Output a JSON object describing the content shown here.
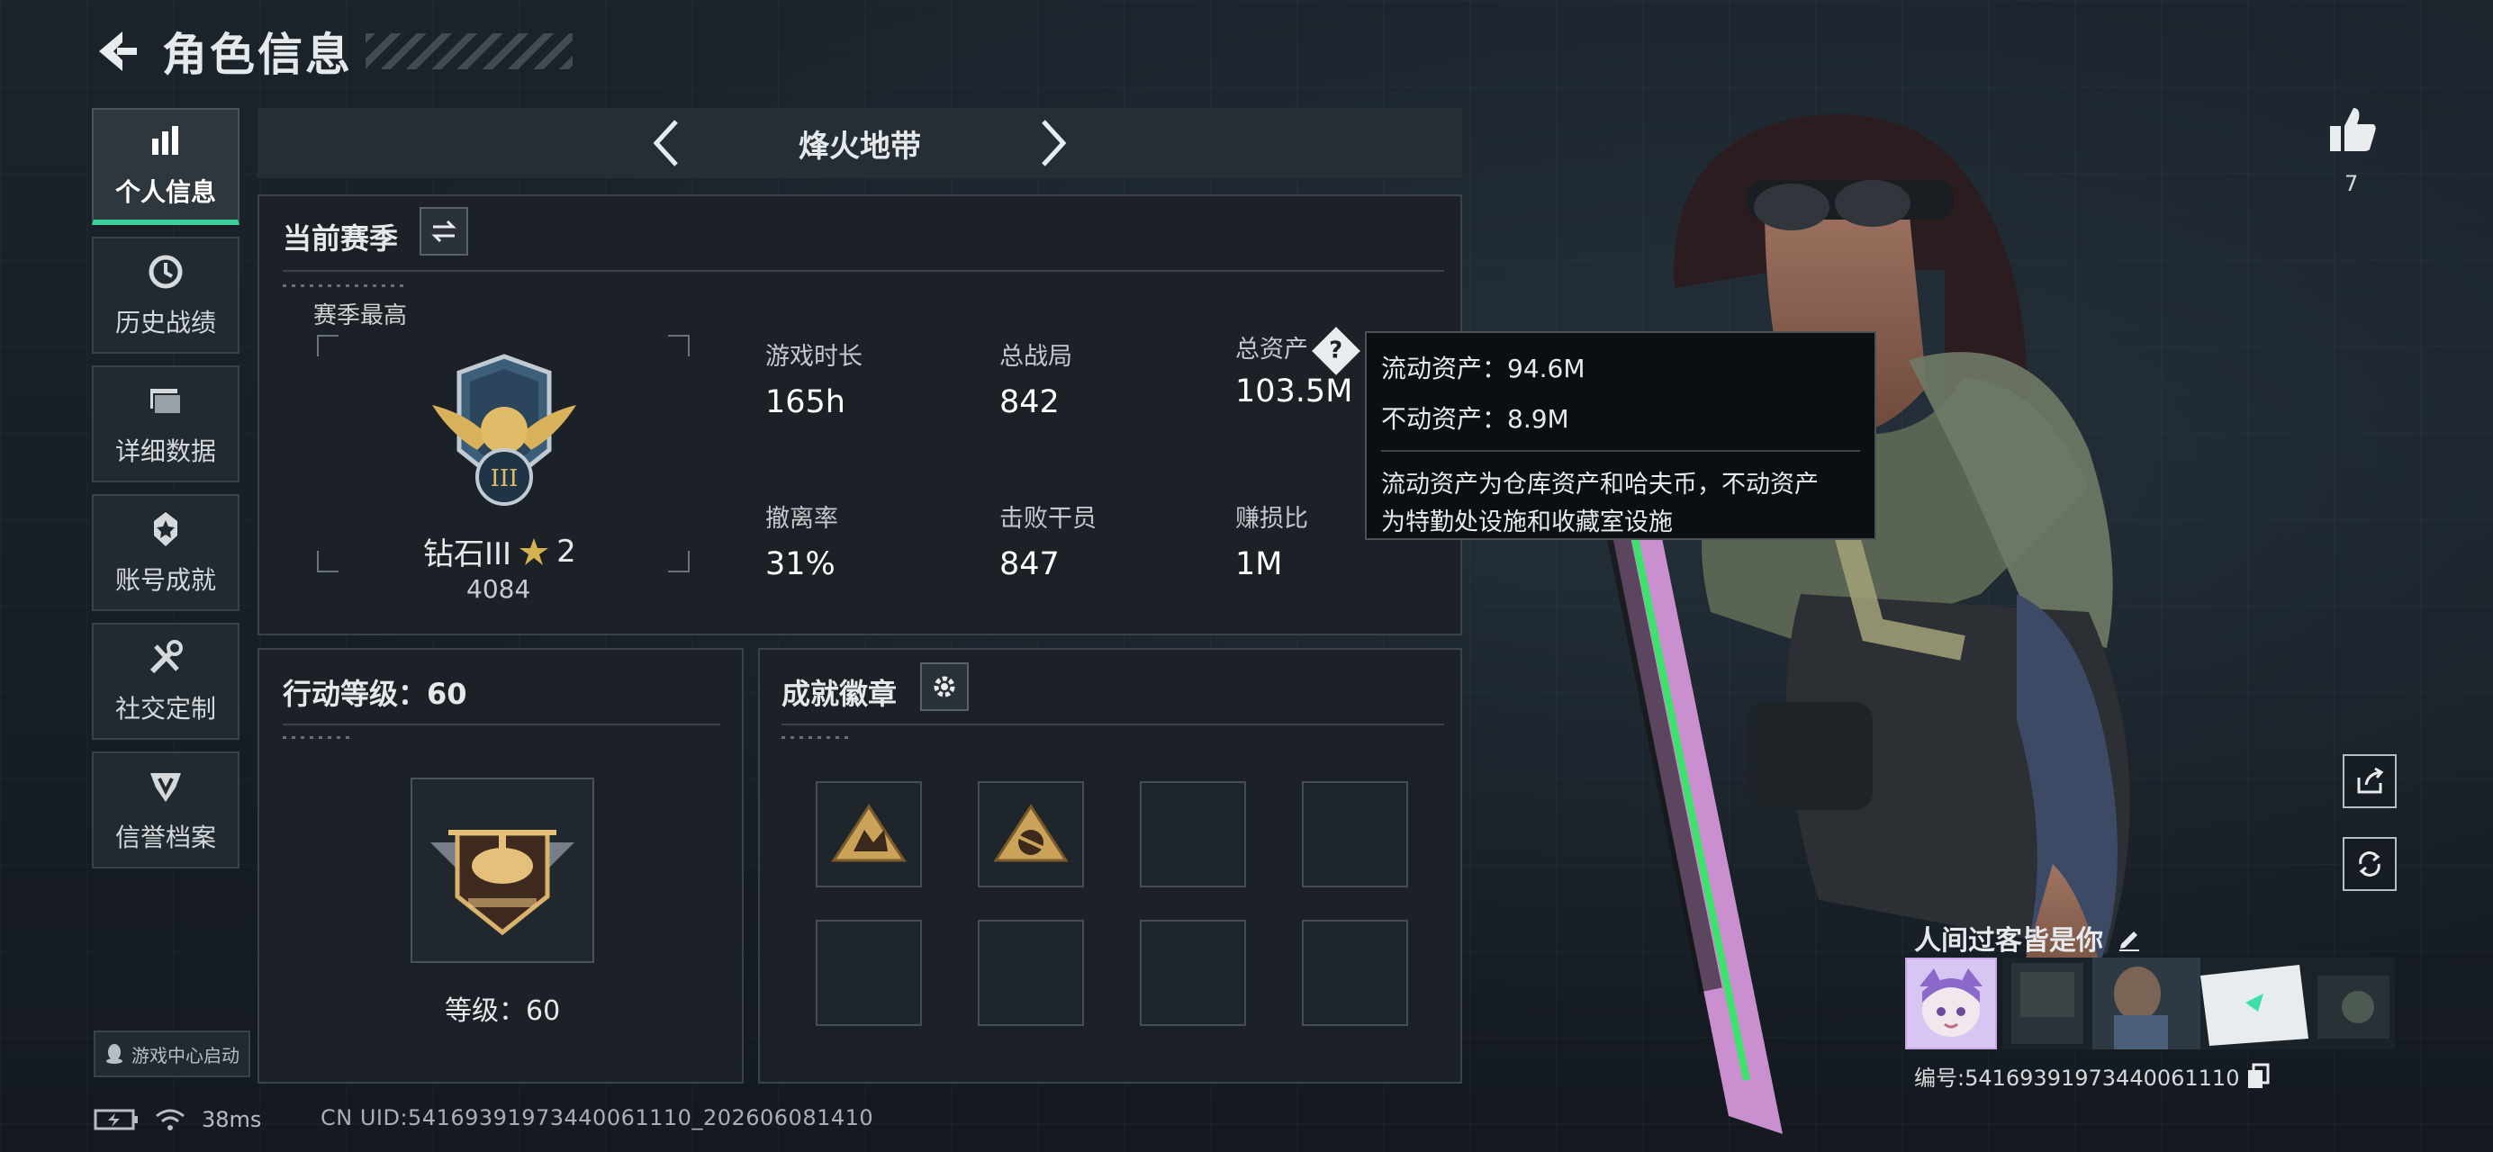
{
  "header": {
    "title": "角色信息"
  },
  "nav": {
    "items": [
      {
        "label": "个人信息",
        "icon": "bar-chart-icon"
      },
      {
        "label": "历史战绩",
        "icon": "history-clock-icon"
      },
      {
        "label": "详细数据",
        "icon": "folder-icon"
      },
      {
        "label": "账号成就",
        "icon": "achievement-medal-icon"
      },
      {
        "label": "社交定制",
        "icon": "tools-icon"
      },
      {
        "label": "信誉档案",
        "icon": "shield-badge-icon"
      }
    ],
    "launch": "游戏中心启动"
  },
  "mode": {
    "label": "烽火地带"
  },
  "season": {
    "title": "当前赛季",
    "best_label": "赛季最高",
    "rank_name": "钻石III",
    "rank_stars": "2",
    "rank_points": "4084",
    "stats": [
      {
        "key": "游戏时长",
        "value": "165h"
      },
      {
        "key": "总战局",
        "value": "842"
      },
      {
        "key": "总资产",
        "value": "103.5M"
      },
      {
        "key": "撤离率",
        "value": "31%"
      },
      {
        "key": "击败干员",
        "value": "847"
      },
      {
        "key": "赚损比",
        "value": "1M"
      }
    ]
  },
  "tooltip": {
    "liquid": "流动资产：94.6M",
    "fixed": "不动资产：8.9M",
    "desc_line1": "流动资产为仓库资产和哈夫币，不动资产",
    "desc_line2": "为特勤处设施和收藏室设施"
  },
  "action_level": {
    "title": "行动等级：60",
    "level_text": "等级：60"
  },
  "achievements": {
    "title": "成就徽章",
    "filled": 2,
    "total": 8
  },
  "profile": {
    "likes": "7",
    "name": "人间过客皆是你",
    "uid": "编号:54169391973440061110"
  },
  "status_bar": {
    "ping": "38ms",
    "cn_uid": "CN UID:54169391973440061110_202606081410"
  },
  "colors": {
    "accent": "#39d39b",
    "gold": "#c9a45a",
    "panel": "#1b2127"
  }
}
